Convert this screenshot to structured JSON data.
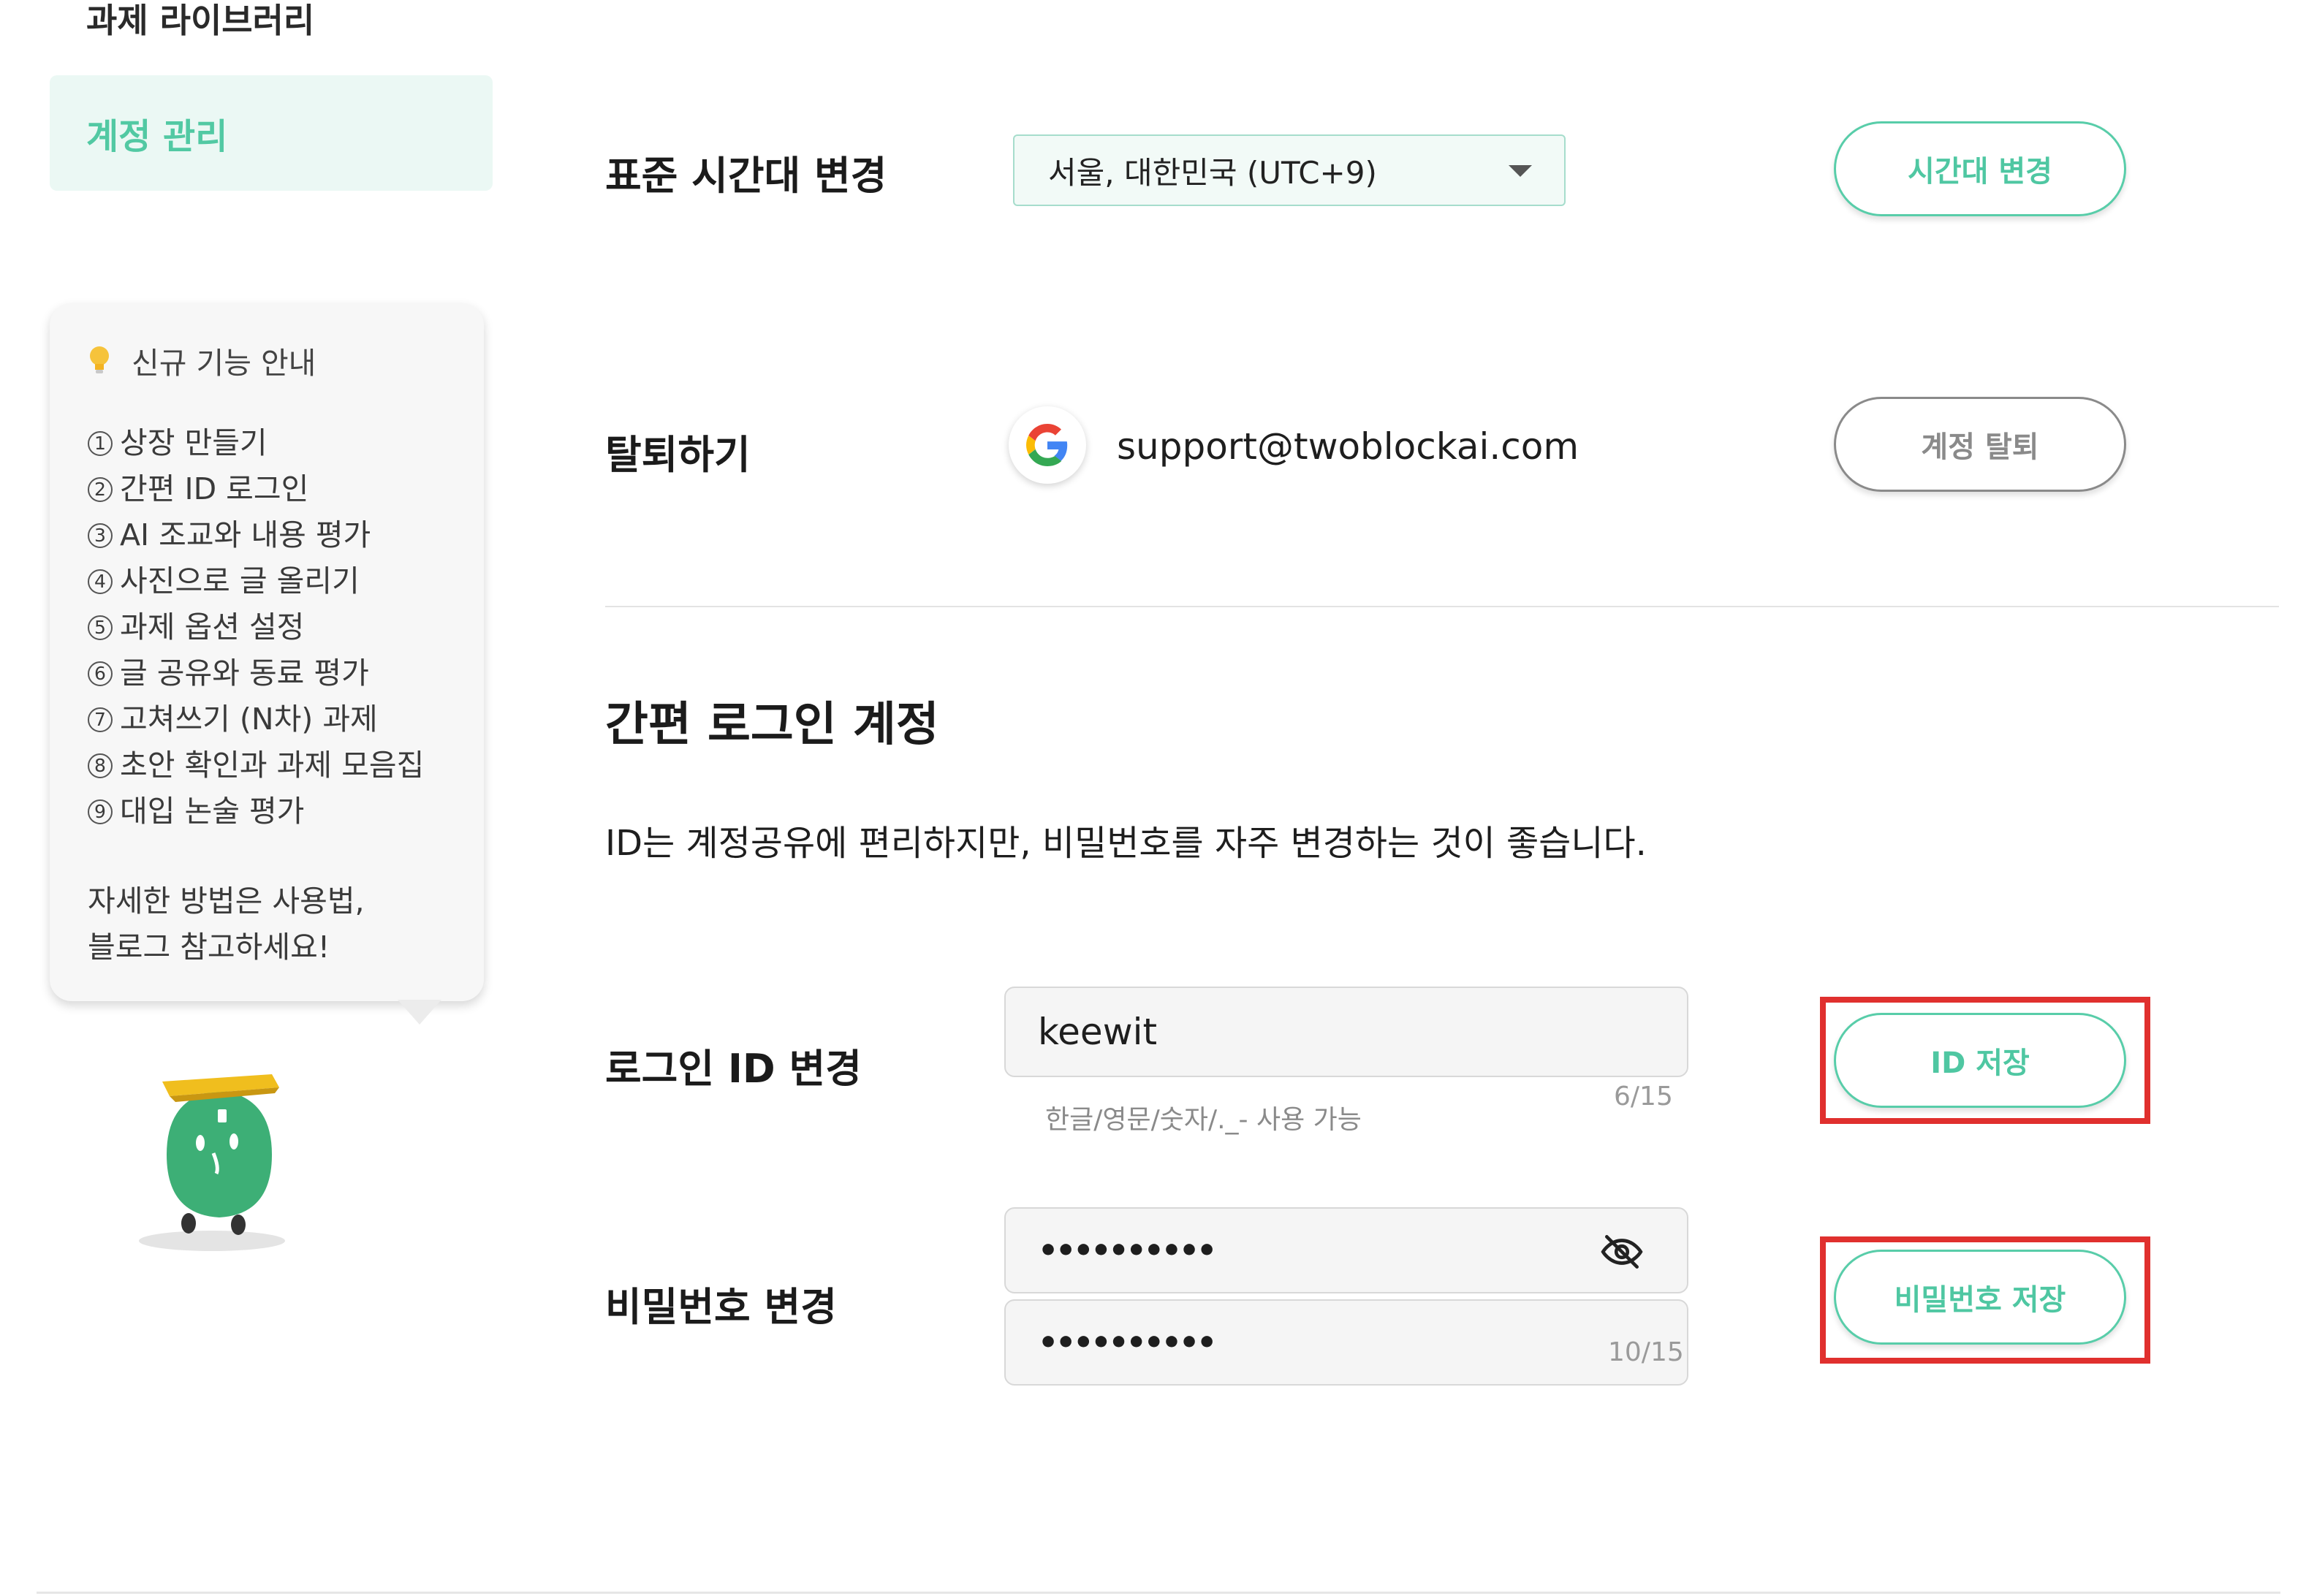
{
  "sidebar": {
    "library_label": "과제 라이브러리",
    "account_label": "계정 관리"
  },
  "tips": {
    "title": "신규 기능 안내",
    "items": [
      {
        "num": "1",
        "text": "상장 만들기"
      },
      {
        "num": "2",
        "text": "간편 ID 로그인"
      },
      {
        "num": "3",
        "text": "AI 조교와 내용 평가"
      },
      {
        "num": "4",
        "text": "사진으로 글 올리기"
      },
      {
        "num": "5",
        "text": "과제 옵션 설정"
      },
      {
        "num": "6",
        "text": "글 공유와 동료 평가"
      },
      {
        "num": "7",
        "text": "고쳐쓰기 (N차) 과제"
      },
      {
        "num": "8",
        "text": "초안 확인과 과제 모음집"
      },
      {
        "num": "9",
        "text": "대입 논술 평가"
      }
    ],
    "footer_line1": "자세한 방법은 사용법,",
    "footer_line2": "블로그 참고하세요!"
  },
  "timezone": {
    "label": "표준 시간대 변경",
    "selected": "서울, 대한민국 (UTC+9)",
    "button": "시간대 변경"
  },
  "withdraw": {
    "label": "탈퇴하기",
    "email": "support@twoblockai.com",
    "button": "계정 탈퇴"
  },
  "simple_login": {
    "title": "간편 로그인 계정",
    "description": "ID는 계정공유에 편리하지만, 비밀번호를 자주 변경하는 것이 좋습니다.",
    "id_label": "로그인 ID 변경",
    "id_value": "keewit",
    "id_hint": "한글/영문/숫자/._- 사용 가능",
    "id_counter": "6/15",
    "id_button": "ID 저장",
    "pw_label": "비밀번호 변경",
    "pw_value": "••••••••••",
    "pw_confirm_value": "••••••••••",
    "pw_counter": "10/15",
    "pw_button": "비밀번호 저장"
  },
  "colors": {
    "accent": "#52c9a3",
    "highlight": "#e0302e"
  },
  "icons": {
    "bulb": "lightbulb-icon",
    "google": "google-logo-icon",
    "eye": "eye-off-icon",
    "caret": "caret-down-icon"
  }
}
